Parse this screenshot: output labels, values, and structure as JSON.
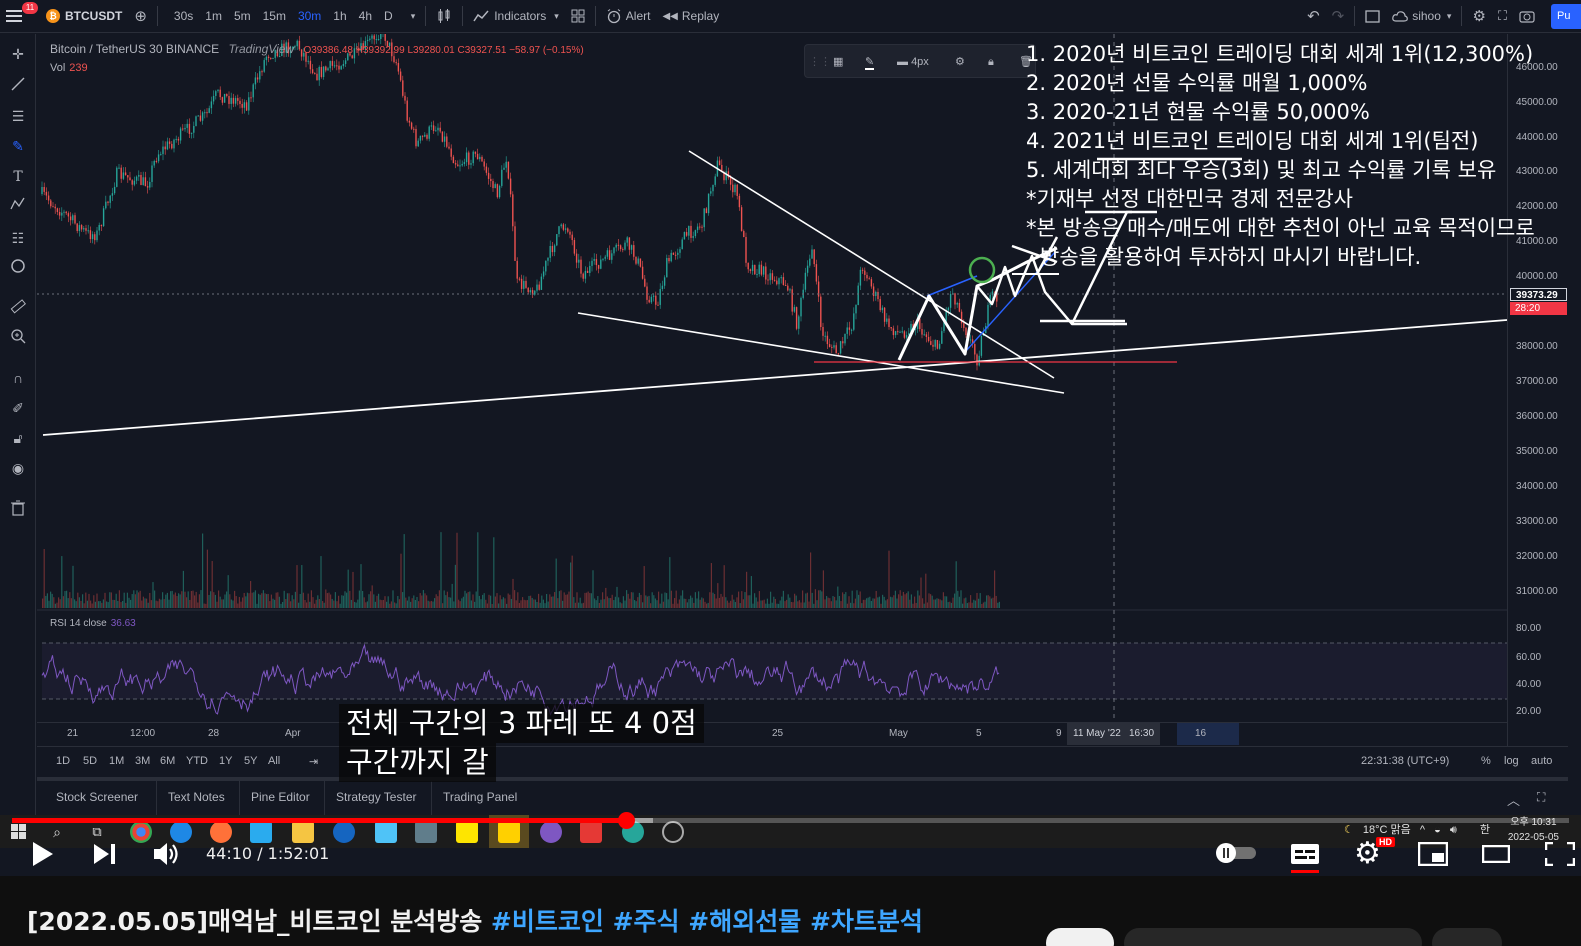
{
  "tradingview": {
    "symbol": "BTCUSDT",
    "notification_count": "11",
    "timeframes": [
      "30s",
      "1m",
      "5m",
      "15m",
      "30m",
      "1h",
      "4h",
      "D"
    ],
    "active_timeframe": "30m",
    "indicators_label": "Indicators",
    "alert_label": "Alert",
    "replay_label": "Replay",
    "user": "sihoo",
    "publish_label": "Pu",
    "legend": {
      "title": "Bitcoin / TetherUS  30  BINANCE",
      "watermark": "TradingView",
      "ohlc": "O39386.48 H39392.99 L39280.01 C39327.51 −58.97 (−0.15%)",
      "vol_label": "Vol",
      "vol_value": "239"
    },
    "rsi": {
      "label": "RSI 14 close",
      "value": "36.63"
    },
    "drawing_toolbar": {
      "width_label": "4px"
    },
    "price_axis": {
      "labels": [
        "46000.00",
        "45000.00",
        "44000.00",
        "43000.00",
        "42000.00",
        "41000.00",
        "40000.00",
        "39373.29",
        "38000.00",
        "37000.00",
        "36000.00",
        "35000.00",
        "34000.00",
        "33000.00",
        "32000.00",
        "31000.00"
      ],
      "last_price": "39373.29",
      "countdown": "28:20",
      "rsi_labels": [
        "80.00",
        "60.00",
        "40.00",
        "20.00"
      ]
    },
    "time_axis": {
      "labels": [
        "21",
        "12:00",
        "28",
        "Apr",
        "25",
        "May",
        "5",
        "9",
        "16"
      ],
      "cursor_date": "11 May '22",
      "cursor_time": "16:30"
    },
    "ranges": [
      "1D",
      "5D",
      "1M",
      "3M",
      "6M",
      "YTD",
      "1Y",
      "5Y",
      "All"
    ],
    "clock": "22:31:38 (UTC+9)",
    "axis_options": [
      "%",
      "log",
      "auto"
    ],
    "panel_tabs": [
      "Stock Screener",
      "Text Notes",
      "Pine Editor",
      "Strategy Tester",
      "Trading Panel"
    ]
  },
  "annotation_lines": [
    "1. 2020년 비트코인 트레이딩 대회 세계 1위(12,300%)",
    "2. 2020년 선물 수익률 매월 1,000%",
    "3. 2020-21년 현물 수익률 50,000%",
    "4. 2021년 비트코인 트레이딩 대회 세계 1위(팀전)",
    "5. 세계대회 최다 우승(3회) 및 최고 수익률 기록 보유",
    "*기재부 선정 대한민국 경제 전문강사",
    "*본 방송은 매수/매도에 대한 추천이 아닌 교육 목적이므로",
    "방송을 활용하여 투자하지 마시기 바랍니다."
  ],
  "subtitle": [
    "전체 구간의 3 파레 또 4 0점",
    "구간까지 갈"
  ],
  "taskbar": {
    "weather": "18°C  맑음",
    "ime": "한",
    "clock_line1": "오후 10:31",
    "clock_line2": "2022-05-05"
  },
  "player": {
    "current_time": "44:10",
    "duration": "1:52:01",
    "time_display": "44:10 / 1:52:01",
    "progress_fraction": 0.3942,
    "buffer_fraction": 0.412,
    "hd_badge": "HD"
  },
  "video": {
    "title_plain": "[2022.05.05]매억남_비트코인 분석방송 ",
    "hashtags": [
      "#비트코인",
      "#주식",
      "#해외선물",
      "#차트분석"
    ]
  },
  "colors": {
    "tv_bg": "#131722",
    "candle_up": "#26a69a",
    "candle_down": "#ef5350",
    "rsi_line": "#7e57c2",
    "yt_red": "#ff0000",
    "hashtag": "#3ea6ff"
  }
}
